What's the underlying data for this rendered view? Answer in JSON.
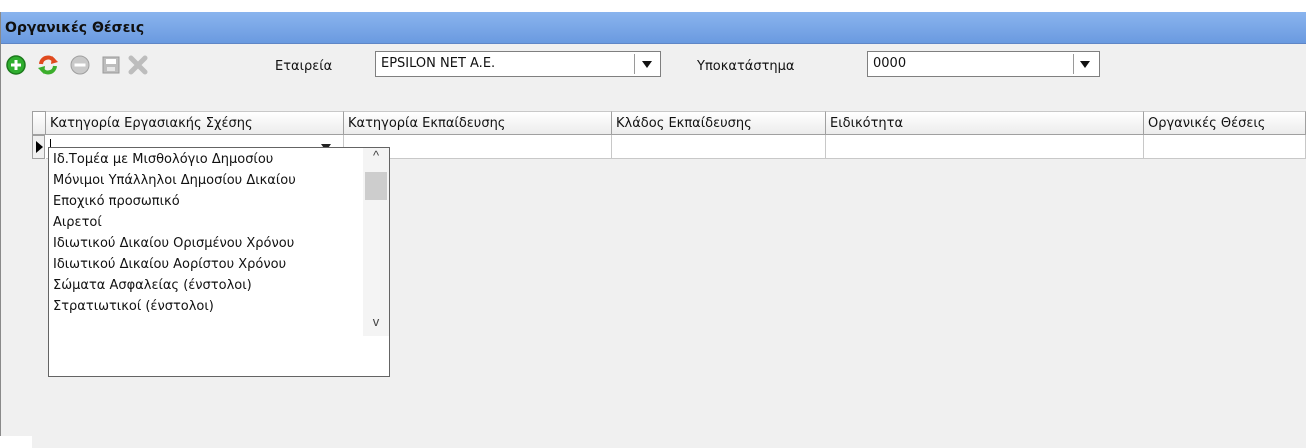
{
  "window": {
    "title": "Οργανικές Θέσεις"
  },
  "toolbar": {
    "icons": [
      "add-icon",
      "refresh-icon",
      "delete-icon",
      "save-icon",
      "cancel-icon"
    ],
    "company_label": "Εταιρεία",
    "company_value": "EPSILON NET A.E.",
    "branch_label": "Υποκατάστημα",
    "branch_value": "0000"
  },
  "grid": {
    "columns": [
      "Κατηγορία Εργασιακής Σχέσης",
      "Κατηγορία Εκπαίδευσης",
      "Κλάδος Εκπαίδευσης",
      "Ειδικότητα",
      "Οργανικές Θέσεις"
    ],
    "current_row_value": ""
  },
  "dropdown": {
    "items": [
      "Ιδ.Τομέα με Μισθολόγιο Δημοσίου",
      "Μόνιμοι Υπάλληλοι Δημοσίου Δικαίου",
      "Εποχικό προσωπικό",
      "Αιρετοί",
      "Ιδιωτικού Δικαίου Ορισμένου Χρόνου",
      "Ιδιωτικού Δικαίου Αορίστου Χρόνου",
      "Σώματα Ασφαλείας (ένστολοι)",
      "Στρατιωτικοί (ένστολοι)"
    ],
    "scroll_up": "^",
    "scroll_down": "v"
  },
  "colors": {
    "titlebar": "#7aa6e8",
    "background": "#f0f0f0"
  }
}
